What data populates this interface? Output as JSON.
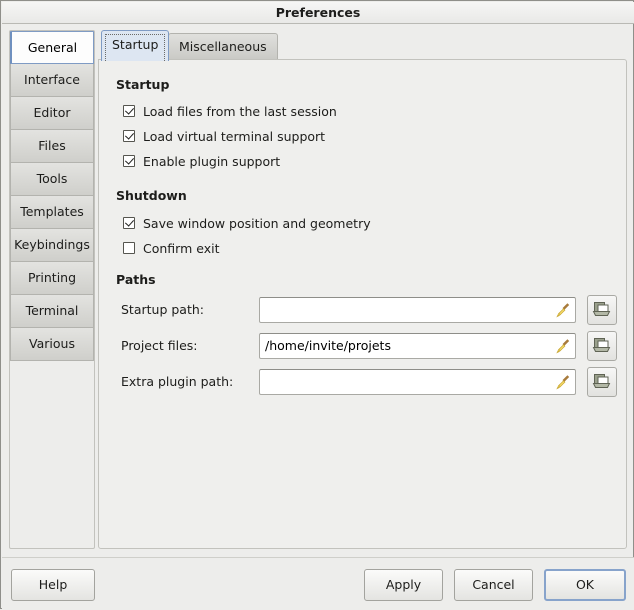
{
  "window": {
    "title": "Preferences"
  },
  "sidebar": {
    "items": [
      {
        "label": "General",
        "selected": true
      },
      {
        "label": "Interface",
        "selected": false
      },
      {
        "label": "Editor",
        "selected": false
      },
      {
        "label": "Files",
        "selected": false
      },
      {
        "label": "Tools",
        "selected": false
      },
      {
        "label": "Templates",
        "selected": false
      },
      {
        "label": "Keybindings",
        "selected": false
      },
      {
        "label": "Printing",
        "selected": false
      },
      {
        "label": "Terminal",
        "selected": false
      },
      {
        "label": "Various",
        "selected": false
      }
    ]
  },
  "tabs": [
    {
      "label": "Startup",
      "active": true
    },
    {
      "label": "Miscellaneous",
      "active": false
    }
  ],
  "panel": {
    "startup": {
      "title": "Startup",
      "options": [
        {
          "label": "Load files from the last session",
          "checked": true
        },
        {
          "label": "Load virtual terminal support",
          "checked": true
        },
        {
          "label": "Enable plugin support",
          "checked": true
        }
      ]
    },
    "shutdown": {
      "title": "Shutdown",
      "options": [
        {
          "label": "Save window position and geometry",
          "checked": true
        },
        {
          "label": "Confirm exit",
          "checked": false
        }
      ]
    },
    "paths": {
      "title": "Paths",
      "rows": [
        {
          "label": "Startup path:",
          "value": "",
          "placeholder": "",
          "clear_icon": "broom-icon",
          "browse_icon": "folder-open-icon"
        },
        {
          "label": "Project files:",
          "value": "/home/invite/projets",
          "placeholder": "",
          "clear_icon": "broom-icon",
          "browse_icon": "folder-open-icon"
        },
        {
          "label": "Extra plugin path:",
          "value": "",
          "placeholder": "",
          "clear_icon": "broom-icon",
          "browse_icon": "folder-open-icon"
        }
      ]
    }
  },
  "actions": {
    "help": "Help",
    "apply": "Apply",
    "cancel": "Cancel",
    "ok": "OK"
  },
  "colors": {
    "window_bg": "#ededeb",
    "panel_bg": "#efefed",
    "selection_blue": "#7f9bc4",
    "active_tab_bg": "#dde6f2",
    "broom_yellow": "#f2d14a",
    "folder_green": "#8d9180"
  }
}
